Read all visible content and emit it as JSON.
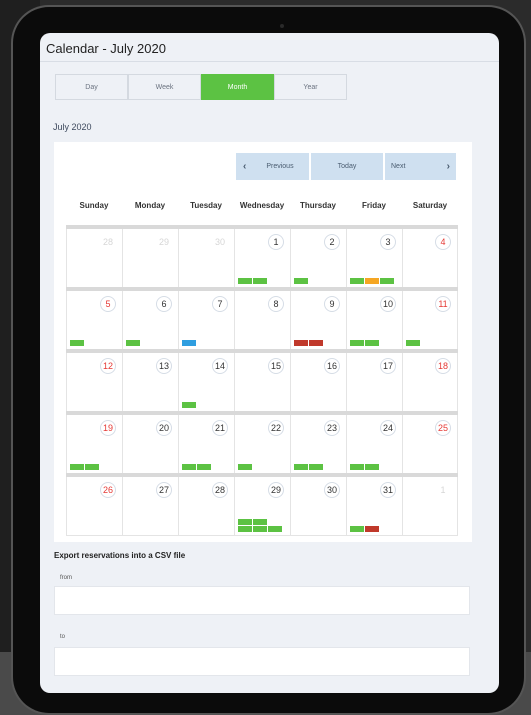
{
  "page": {
    "title": "Calendar - July 2020",
    "view_tabs": [
      {
        "label": "Day",
        "active": false
      },
      {
        "label": "Week",
        "active": false
      },
      {
        "label": "Month",
        "active": true
      },
      {
        "label": "Year",
        "active": false
      }
    ],
    "month_label": "July 2020",
    "nav": {
      "previous": "Previous",
      "today": "Today",
      "next": "Next"
    },
    "weekdays": [
      "Sunday",
      "Monday",
      "Tuesday",
      "Wednesday",
      "Thursday",
      "Friday",
      "Saturday"
    ],
    "colors": {
      "green": "#5cc243",
      "orange": "#f5a623",
      "red": "#c0392b",
      "blue": "#2f9ee0",
      "accent": "#5cc243"
    },
    "weeks": [
      [
        {
          "day": "28",
          "type": "other",
          "bars": []
        },
        {
          "day": "29",
          "type": "other",
          "bars": []
        },
        {
          "day": "30",
          "type": "other",
          "bars": []
        },
        {
          "day": "1",
          "type": "weekday",
          "bars": [
            "green",
            "green"
          ]
        },
        {
          "day": "2",
          "type": "weekday",
          "bars": [
            "green"
          ]
        },
        {
          "day": "3",
          "type": "weekday",
          "bars": [
            "green",
            "orange",
            "green"
          ]
        },
        {
          "day": "4",
          "type": "weekend",
          "bars": []
        }
      ],
      [
        {
          "day": "5",
          "type": "weekend",
          "bars": [
            "green"
          ]
        },
        {
          "day": "6",
          "type": "weekday",
          "bars": [
            "green"
          ]
        },
        {
          "day": "7",
          "type": "weekday",
          "bars": [
            "blue"
          ]
        },
        {
          "day": "8",
          "type": "weekday",
          "bars": []
        },
        {
          "day": "9",
          "type": "weekday",
          "bars": [
            "red",
            "red"
          ]
        },
        {
          "day": "10",
          "type": "weekday",
          "bars": [
            "green",
            "green"
          ]
        },
        {
          "day": "11",
          "type": "weekend",
          "bars": [
            "green"
          ]
        }
      ],
      [
        {
          "day": "12",
          "type": "weekend",
          "bars": []
        },
        {
          "day": "13",
          "type": "weekday",
          "bars": []
        },
        {
          "day": "14",
          "type": "weekday",
          "bars": [
            "green"
          ]
        },
        {
          "day": "15",
          "type": "weekday",
          "bars": []
        },
        {
          "day": "16",
          "type": "weekday",
          "bars": []
        },
        {
          "day": "17",
          "type": "weekday",
          "bars": []
        },
        {
          "day": "18",
          "type": "weekend",
          "bars": []
        }
      ],
      [
        {
          "day": "19",
          "type": "weekend",
          "bars": [
            "green",
            "green"
          ]
        },
        {
          "day": "20",
          "type": "weekday",
          "bars": []
        },
        {
          "day": "21",
          "type": "weekday",
          "bars": [
            "green",
            "green"
          ]
        },
        {
          "day": "22",
          "type": "weekday",
          "bars": [
            "green"
          ]
        },
        {
          "day": "23",
          "type": "weekday",
          "bars": [
            "green",
            "green"
          ]
        },
        {
          "day": "24",
          "type": "weekday",
          "bars": [
            "green",
            "green"
          ]
        },
        {
          "day": "25",
          "type": "weekend",
          "bars": []
        }
      ],
      [
        {
          "day": "26",
          "type": "weekend",
          "bars": []
        },
        {
          "day": "27",
          "type": "weekday",
          "bars": []
        },
        {
          "day": "28",
          "type": "weekday",
          "bars": []
        },
        {
          "day": "29",
          "type": "weekday",
          "bars": [
            "green",
            "green",
            "green",
            "green",
            "green"
          ]
        },
        {
          "day": "30",
          "type": "weekday",
          "bars": []
        },
        {
          "day": "31",
          "type": "weekday",
          "bars": [
            "green",
            "red"
          ]
        },
        {
          "day": "1",
          "type": "other",
          "bars": []
        }
      ]
    ],
    "export": {
      "title": "Export reservations into a CSV file",
      "from_label": "from",
      "to_label": "to",
      "from_value": "",
      "to_value": ""
    }
  }
}
